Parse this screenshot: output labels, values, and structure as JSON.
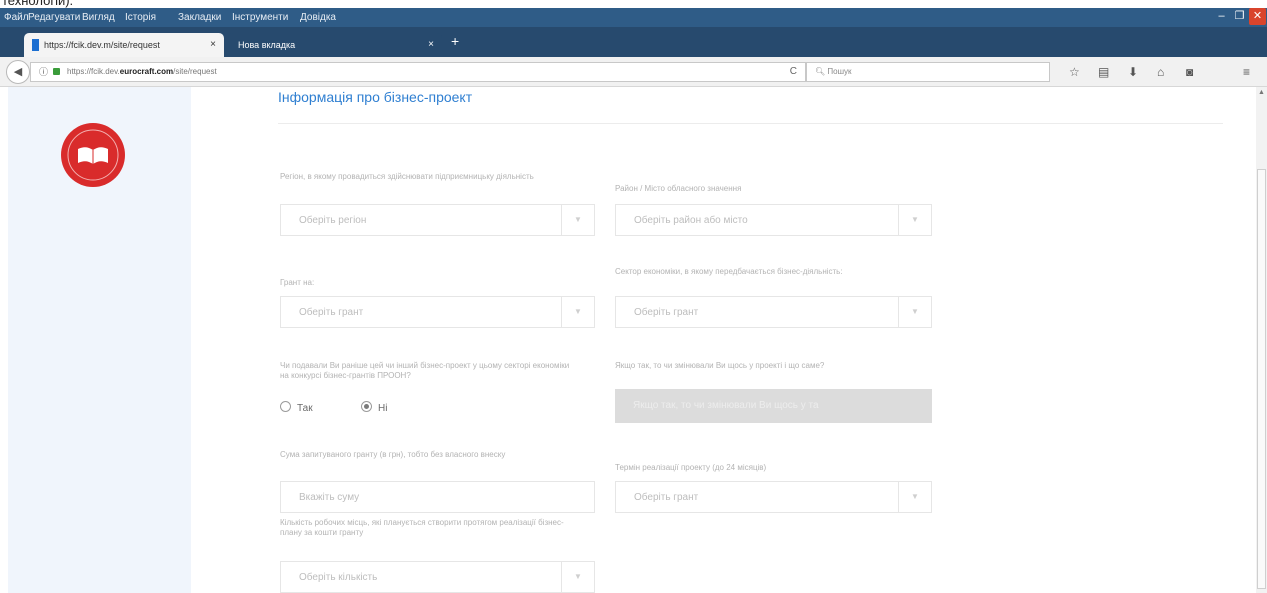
{
  "caption": "технологій).",
  "menu": [
    "Файл",
    "Редагувати",
    "Вигляд",
    "Історія",
    "Закладки",
    "Інструменти",
    "Довідка"
  ],
  "window_controls": [
    "–",
    "❐",
    "✕"
  ],
  "tabs": [
    {
      "title": "https://fcik.dev.m/site/request"
    },
    {
      "title": "Нова вкладка"
    }
  ],
  "tab_close": "×",
  "new_tab": "+",
  "address": {
    "prefix": "https://fcik.dev.",
    "domain": "eurocraft.com",
    "suffix": "/site/request",
    "info_icon": "ⓘ",
    "reload_icon": "C"
  },
  "search": {
    "placeholder": "Пошук"
  },
  "toolbar_icons": [
    "star-icon",
    "library-icon",
    "download-icon",
    "home-icon",
    "pocket-icon",
    "menu-icon"
  ],
  "toolbar_glyphs": [
    "☆",
    "▤",
    "⬇",
    "⌂",
    "◙",
    "≡"
  ],
  "page": {
    "section_title": "Інформація про бізнес-проект",
    "fields": {
      "region_label": "Регіон, в якому провадиться здійснювати підприємницьку діяльність",
      "region_value": "Оберіть регіон",
      "district_label": "Район / Місто обласного значення",
      "district_value": "Оберіть район або місто",
      "grant_label": "Грант на:",
      "grant_value": "Оберіть грант",
      "sector_label": "Сектор економіки, в якому передбачається бізнес-діяльність:",
      "sector_value": "Оберіть грант",
      "prev_label": "Чи подавали Ви раніше цей чи інший бізнес-проект у цьому секторі економіки на конкурсі бізнес-грантів ПРООН?",
      "radio_yes": "Так",
      "radio_no": "Ні",
      "radio_selected": "no",
      "changes_label": "Якщо так, то чи змінювали Ви щось у проекті і що саме?",
      "changes_placeholder": "Якщо так, то чи змінювали Ви щось у та",
      "amount_label": "Сума запитуваного гранту (в грн), тобто без власного внеску",
      "amount_placeholder": "Вкажіть суму",
      "term_label": "Термін реалізації проекту (до 24 місяців)",
      "term_value": "Оберіть грант",
      "jobs_label": "Кількість робочих місць, які планується створити протягом реалізації бізнес-плану за кошти гранту",
      "jobs_value": "Оберіть кількість"
    }
  },
  "colors": {
    "accent": "#2f7fd1",
    "logo_red": "#d92b2b",
    "menubar": "#2f5c87",
    "tabbar": "#274a6e"
  }
}
